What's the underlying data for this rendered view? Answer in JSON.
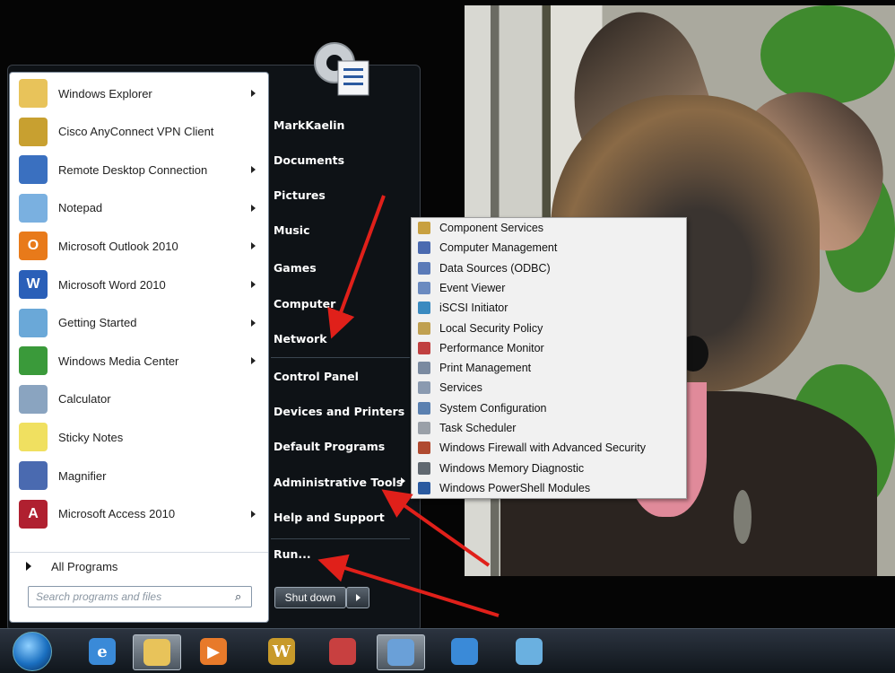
{
  "programs": [
    {
      "label": "Windows Explorer",
      "icon": "windows-explorer-icon",
      "color": "#e8c35a",
      "glyph": "",
      "has_submenu": true
    },
    {
      "label": "Cisco AnyConnect VPN Client",
      "icon": "cisco-vpn-icon",
      "color": "#c8a030",
      "glyph": "",
      "has_submenu": false
    },
    {
      "label": "Remote Desktop Connection",
      "icon": "remote-desktop-icon",
      "color": "#3a70c0",
      "glyph": "",
      "has_submenu": true
    },
    {
      "label": "Notepad",
      "icon": "notepad-icon",
      "color": "#7ab0e0",
      "glyph": "",
      "has_submenu": true
    },
    {
      "label": "Microsoft Outlook 2010",
      "icon": "outlook-icon",
      "color": "#e87a1a",
      "glyph": "O",
      "has_submenu": true
    },
    {
      "label": "Microsoft Word 2010",
      "icon": "word-icon",
      "color": "#2a5fb8",
      "glyph": "W",
      "has_submenu": true
    },
    {
      "label": "Getting Started",
      "icon": "getting-started-icon",
      "color": "#6aa8d8",
      "glyph": "",
      "has_submenu": true
    },
    {
      "label": "Windows Media Center",
      "icon": "media-center-icon",
      "color": "#3a9a3a",
      "glyph": "",
      "has_submenu": true
    },
    {
      "label": "Calculator",
      "icon": "calculator-icon",
      "color": "#8aa4c0",
      "glyph": "",
      "has_submenu": false
    },
    {
      "label": "Sticky Notes",
      "icon": "sticky-notes-icon",
      "color": "#f0e060",
      "glyph": "",
      "has_submenu": false
    },
    {
      "label": "Magnifier",
      "icon": "magnifier-icon",
      "color": "#4a6ab0",
      "glyph": "",
      "has_submenu": false
    },
    {
      "label": "Microsoft Access 2010",
      "icon": "access-icon",
      "color": "#b02030",
      "glyph": "A",
      "has_submenu": true
    }
  ],
  "all_programs": "All Programs",
  "search": {
    "placeholder": "Search programs and files"
  },
  "right_links": [
    {
      "label": "MarkKaelin",
      "name": "user-name-link"
    },
    {
      "label": "Documents",
      "name": "documents-link"
    },
    {
      "label": "Pictures",
      "name": "pictures-link"
    },
    {
      "label": "Music",
      "name": "music-link"
    },
    {
      "label": "Games",
      "name": "games-link"
    },
    {
      "label": "Computer",
      "name": "computer-link"
    },
    {
      "label": "Network",
      "name": "network-link"
    },
    {
      "label": "Control Panel",
      "name": "control-panel-link"
    },
    {
      "label": "Devices and Printers",
      "name": "devices-printers-link"
    },
    {
      "label": "Default Programs",
      "name": "default-programs-link"
    },
    {
      "label": "Administrative Tools",
      "name": "administrative-tools-link"
    },
    {
      "label": "Help and Support",
      "name": "help-support-link"
    },
    {
      "label": "Run...",
      "name": "run-link"
    }
  ],
  "shutdown_label": "Shut down",
  "admin_tools": [
    {
      "label": "Component Services",
      "color": "#c8a040"
    },
    {
      "label": "Computer Management",
      "color": "#4a6ab0"
    },
    {
      "label": "Data Sources (ODBC)",
      "color": "#5a7ab8"
    },
    {
      "label": "Event Viewer",
      "color": "#6a8ac0"
    },
    {
      "label": "iSCSI Initiator",
      "color": "#3a8ac0"
    },
    {
      "label": "Local Security Policy",
      "color": "#c0a050"
    },
    {
      "label": "Performance Monitor",
      "color": "#c04040"
    },
    {
      "label": "Print Management",
      "color": "#7a8aa0"
    },
    {
      "label": "Services",
      "color": "#8a9ab0"
    },
    {
      "label": "System Configuration",
      "color": "#5a80b0"
    },
    {
      "label": "Task Scheduler",
      "color": "#9aa0a8"
    },
    {
      "label": "Windows Firewall with Advanced Security",
      "color": "#b04a30"
    },
    {
      "label": "Windows Memory Diagnostic",
      "color": "#606870"
    },
    {
      "label": "Windows PowerShell Modules",
      "color": "#2a5aa0"
    }
  ],
  "taskbar": [
    {
      "name": "internet-explorer-icon",
      "active": false,
      "color": "#3a8ad8",
      "glyph": "e"
    },
    {
      "name": "windows-explorer-taskbar-icon",
      "active": true,
      "color": "#e8c35a",
      "glyph": ""
    },
    {
      "name": "media-player-icon",
      "active": false,
      "color": "#e87a2a",
      "glyph": "▶"
    },
    {
      "name": "world-of-warcraft-icon",
      "active": false,
      "color": "#c89a2a",
      "glyph": "W"
    },
    {
      "name": "snipping-tool-icon",
      "active": false,
      "color": "#c84040",
      "glyph": ""
    },
    {
      "name": "paint-icon",
      "active": true,
      "color": "#6aa0d8",
      "glyph": ""
    },
    {
      "name": "lifebuoy-icon",
      "active": false,
      "color": "#3a8ad8",
      "glyph": ""
    },
    {
      "name": "web-page-icon",
      "active": false,
      "color": "#6ab0e0",
      "glyph": ""
    }
  ],
  "colors": {
    "arrow": "#e0201a"
  }
}
